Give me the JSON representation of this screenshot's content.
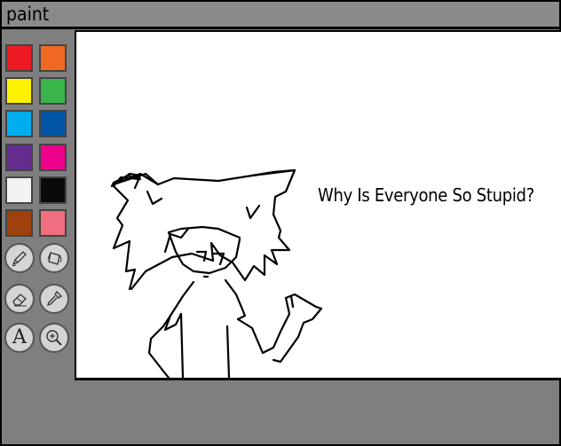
{
  "app": {
    "title": "paint"
  },
  "palette": {
    "colors": [
      {
        "name": "red",
        "hex": "#ed1c24"
      },
      {
        "name": "orange",
        "hex": "#f26a21"
      },
      {
        "name": "yellow",
        "hex": "#fff200"
      },
      {
        "name": "green",
        "hex": "#39b54a"
      },
      {
        "name": "sky-blue",
        "hex": "#00aeef"
      },
      {
        "name": "blue",
        "hex": "#0054a6"
      },
      {
        "name": "purple",
        "hex": "#662d91"
      },
      {
        "name": "magenta",
        "hex": "#ec008c"
      },
      {
        "name": "white",
        "hex": "#f2f2f2"
      },
      {
        "name": "black",
        "hex": "#0a0a0a"
      },
      {
        "name": "brown",
        "hex": "#a0410d"
      },
      {
        "name": "pink",
        "hex": "#f26d7d"
      }
    ]
  },
  "tools": [
    {
      "name": "pencil",
      "icon": "pencil-icon"
    },
    {
      "name": "fill",
      "icon": "paint-bucket-icon"
    },
    {
      "name": "eraser",
      "icon": "eraser-icon"
    },
    {
      "name": "color-picker",
      "icon": "eyedropper-icon"
    },
    {
      "name": "text",
      "icon": "text-icon",
      "glyph": "A"
    },
    {
      "name": "zoom",
      "icon": "zoom-in-icon"
    }
  ],
  "canvas": {
    "text": "Why Is Everyone So Stupid?",
    "background": "#ffffff"
  }
}
